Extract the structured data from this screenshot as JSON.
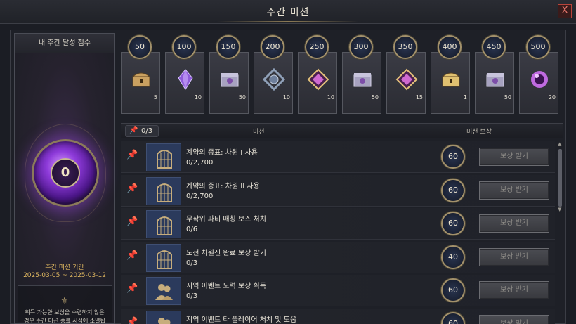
{
  "window": {
    "title": "주간 미션",
    "close_label": "X"
  },
  "score_panel": {
    "title": "내 주간 달성 점수",
    "score": "0",
    "period_label": "주간 미션 기간",
    "period_dates": "2025-03-05 ~ 2025-03-12",
    "notice_icon": "⚜",
    "notice": "획득 가능한 보상을 수령하지 않은 경우 주간 미션 종료 시점에 소멸됩니다."
  },
  "milestones": [
    {
      "score": "50",
      "icon": "treasure-chest-icon",
      "count": "5",
      "color": "#c9a060"
    },
    {
      "score": "100",
      "icon": "purple-crystal-icon",
      "count": "10",
      "color": "#8e5bd8"
    },
    {
      "score": "150",
      "icon": "silver-box-icon",
      "count": "50",
      "color": "#a7a2c0"
    },
    {
      "score": "200",
      "icon": "ornate-frame-icon",
      "count": "10",
      "color": "#8fa0b8"
    },
    {
      "score": "250",
      "icon": "pink-gem-icon",
      "count": "10",
      "color": "#d06ad0"
    },
    {
      "score": "300",
      "icon": "silver-box-icon",
      "count": "50",
      "color": "#a7a2c0"
    },
    {
      "score": "350",
      "icon": "pink-gem-icon",
      "count": "15",
      "color": "#d06ad0"
    },
    {
      "score": "400",
      "icon": "golden-chest-icon",
      "count": "1",
      "color": "#e0c070"
    },
    {
      "score": "450",
      "icon": "silver-box-icon",
      "count": "50",
      "color": "#a7a2c0"
    },
    {
      "score": "500",
      "icon": "purple-orb-icon",
      "count": "20",
      "color": "#c06ae0"
    }
  ],
  "list_header": {
    "pin_count": "0/3",
    "mission_col": "미션",
    "reward_col": "미션 보상"
  },
  "missions": [
    {
      "title": "계약의 증표: 차원 I 사용",
      "progress": "0/2,700",
      "points": "60",
      "claim": "보상 받기",
      "icon": "gate-icon"
    },
    {
      "title": "계약의 증표: 차원 II 사용",
      "progress": "0/2,700",
      "points": "60",
      "claim": "보상 받기",
      "icon": "gate-icon"
    },
    {
      "title": "무작위 파티 매칭 보스 처치",
      "progress": "0/6",
      "points": "60",
      "claim": "보상 받기",
      "icon": "gate-icon"
    },
    {
      "title": "도전 차원진 완료 보상 받기",
      "progress": "0/3",
      "points": "40",
      "claim": "보상 받기",
      "icon": "gate-icon"
    },
    {
      "title": "지역 이벤트 노력 보상 획득",
      "progress": "0/3",
      "points": "60",
      "claim": "보상 받기",
      "icon": "party-icon"
    },
    {
      "title": "지역 이벤트 타 플레이어 처치 및 도움",
      "progress": "",
      "points": "60",
      "claim": "보상 받기",
      "icon": "party-icon"
    }
  ]
}
